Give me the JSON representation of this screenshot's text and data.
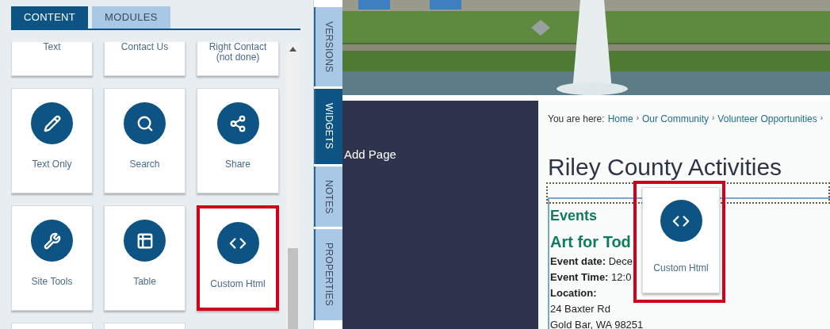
{
  "panel_tabs": [
    {
      "label": "CONTENT",
      "selected": true
    },
    {
      "label": "MODULES",
      "selected": false
    }
  ],
  "tiles": [
    {
      "label": "Text",
      "highlighted": false
    },
    {
      "label": "Contact Us",
      "highlighted": false
    },
    {
      "label": "Right Contact (not done)",
      "highlighted": false
    },
    {
      "label": "Text Only",
      "highlighted": false
    },
    {
      "label": "Search",
      "highlighted": false
    },
    {
      "label": "Share",
      "highlighted": false
    },
    {
      "label": "Site Tools",
      "highlighted": false
    },
    {
      "label": "Table",
      "highlighted": false
    },
    {
      "label": "Custom Html",
      "highlighted": true
    }
  ],
  "side_tabs": [
    {
      "label": "VERSIONS",
      "selected": false
    },
    {
      "label": "WIDGETS",
      "selected": true
    },
    {
      "label": "NOTES",
      "selected": false
    },
    {
      "label": "PROPERTIES",
      "selected": false
    }
  ],
  "nav_panel": {
    "item": "Add Page"
  },
  "page": {
    "breadcrumb_prefix": "You are here:",
    "breadcrumb": [
      "Home",
      "Our Community",
      "Volunteer Opportunities"
    ],
    "separator": "›",
    "title": "Riley County Activities",
    "section": "Events",
    "event_title": "Art for Tod",
    "details": [
      {
        "label": "Event date:",
        "value": "Dece"
      },
      {
        "label": "Event Time:",
        "value": "12:0"
      },
      {
        "label": "Location:"
      }
    ],
    "address": [
      "24 Baxter Rd",
      "Gold Bar, WA 98251"
    ]
  },
  "drag_tile": {
    "label": "Custom Html"
  }
}
